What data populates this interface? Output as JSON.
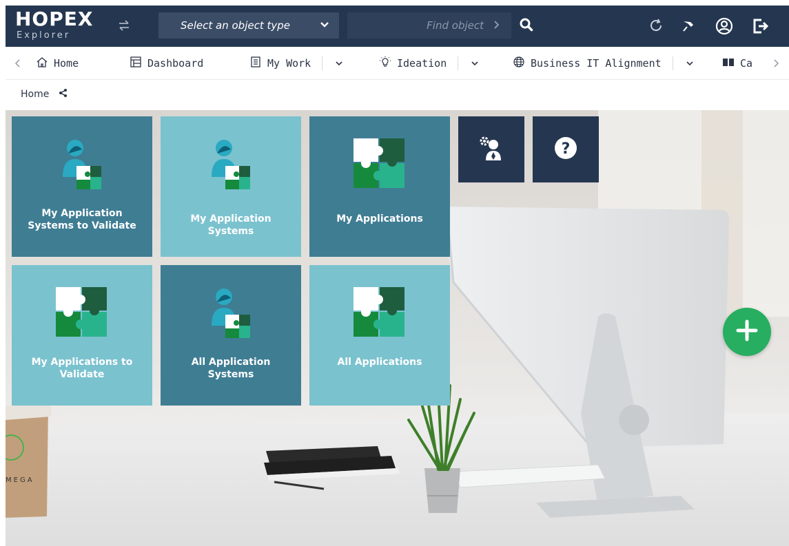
{
  "header": {
    "logo_line1": "HOPEX",
    "logo_line2": "Explorer",
    "object_type_placeholder": "Select an object type",
    "find_placeholder": "Find object"
  },
  "nav": {
    "items": [
      {
        "label": "Home",
        "icon": "home-icon"
      },
      {
        "label": "Dashboard",
        "icon": "dashboard-icon"
      },
      {
        "label": "My Work",
        "icon": "document-icon"
      },
      {
        "label": "Ideation",
        "icon": "lightbulb-icon"
      },
      {
        "label": "Business IT Alignment",
        "icon": "globe-icon"
      },
      {
        "label": "Ca",
        "icon": "book-icon"
      }
    ]
  },
  "breadcrumb": {
    "current": "Home"
  },
  "tiles": [
    {
      "label": "My Application Systems to Validate",
      "icon": "user-puzzle-icon"
    },
    {
      "label": "My Application Systems",
      "icon": "user-puzzle-icon"
    },
    {
      "label": "My Applications",
      "icon": "puzzle-icon"
    },
    {
      "label": "My Applications to Validate",
      "icon": "puzzle-icon"
    },
    {
      "label": "All Application Systems",
      "icon": "user-puzzle-icon"
    },
    {
      "label": "All Applications",
      "icon": "puzzle-icon"
    }
  ],
  "colors": {
    "header_bg": "#253750",
    "tile_dark": "#3f7d93",
    "tile_light": "#7bc2cf",
    "add_button": "#27ae60"
  }
}
